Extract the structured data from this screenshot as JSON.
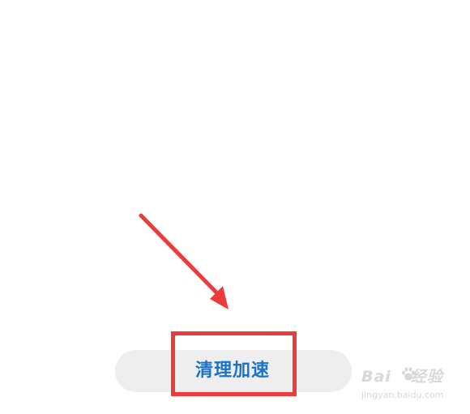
{
  "action": {
    "clean_label": "清理加速"
  },
  "annotation": {
    "highlight_color": "#ec3b3b",
    "arrow_color": "#ec3b3b"
  },
  "colors": {
    "button_bg": "#eeeeee",
    "button_text": "#1a73c8"
  },
  "watermark": {
    "title_left": "Bai",
    "title_right": "经验",
    "icon": "baidu-paw-icon",
    "subtitle": "jingyan.baidu.com"
  }
}
